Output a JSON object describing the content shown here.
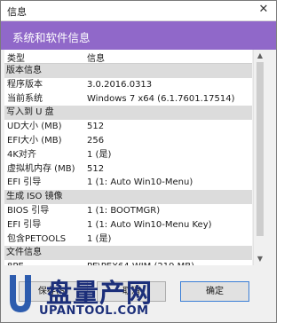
{
  "window": {
    "title": "信息",
    "close_glyph": "✕",
    "header_title": "系统和软件信息"
  },
  "table": {
    "columns": [
      "类型",
      "信息"
    ],
    "rows": [
      {
        "type": "group",
        "label": "版本信息",
        "value": ""
      },
      {
        "type": "item",
        "label": "程序版本",
        "value": "3.0.2016.0313"
      },
      {
        "type": "item",
        "label": "当前系统",
        "value": "Windows 7 x64 (6.1.7601.17514)"
      },
      {
        "type": "group",
        "label": "写入到 U 盘",
        "value": ""
      },
      {
        "type": "item",
        "label": "UD大小 (MB)",
        "value": "512"
      },
      {
        "type": "item",
        "label": "EFI大小 (MB)",
        "value": "256"
      },
      {
        "type": "item",
        "label": "4K对齐",
        "value": "1 (是)"
      },
      {
        "type": "item",
        "label": "虚拟机内存 (MB)",
        "value": "512"
      },
      {
        "type": "item",
        "label": "EFI 引导",
        "value": "1 (1: Auto Win10-Menu)"
      },
      {
        "type": "group",
        "label": "生成 ISO 镜像",
        "value": ""
      },
      {
        "type": "item",
        "label": "BIOS 引导",
        "value": "1 (1: BOOTMGR)"
      },
      {
        "type": "item",
        "label": "EFI 引导",
        "value": "1 (1: Auto Win10-Menu Key)"
      },
      {
        "type": "item",
        "label": "包含PETOOLS",
        "value": "1 (是)"
      },
      {
        "type": "group",
        "label": "文件信息",
        "value": ""
      },
      {
        "type": "item",
        "label": "8PE",
        "value": "PE\\PEX64.WIM (219 MB)"
      }
    ]
  },
  "buttons": {
    "save": "保存(S)",
    "cancel": "取消",
    "ok": "确定"
  },
  "watermark": {
    "site_name": "盘量产网",
    "url": "UPANTOOL.COM"
  },
  "icons": {
    "close": "close-icon",
    "scroll_up": "chevron-up-icon",
    "scroll_down": "chevron-down-icon",
    "logo": "usb-u-logo"
  }
}
